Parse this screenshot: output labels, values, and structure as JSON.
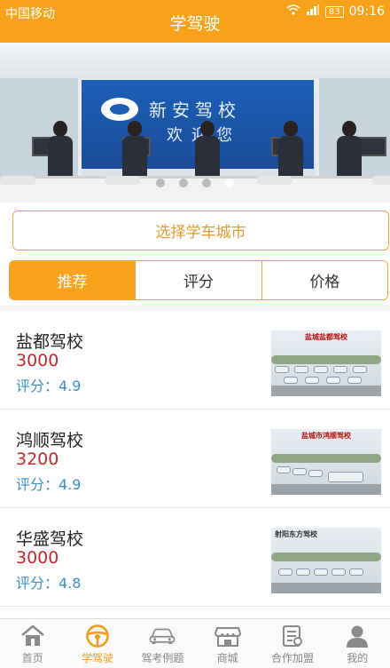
{
  "status_bar": {
    "carrier": "中国移动",
    "battery": "83",
    "time": "09:16"
  },
  "header": {
    "title": "学驾驶"
  },
  "banner": {
    "sign_line1": "新安驾校",
    "sign_line2": "欢迎您",
    "slide_count": 4,
    "active_slide": 4
  },
  "city_button": {
    "label": "选择学车城市"
  },
  "tabs": [
    {
      "label": "推荐",
      "active": true
    },
    {
      "label": "评分",
      "active": false
    },
    {
      "label": "价格",
      "active": false
    }
  ],
  "schools": [
    {
      "name": "盐都驾校",
      "price": "3000",
      "rating": "评分：4.9",
      "thumb_caption": "盐城盐都驾校"
    },
    {
      "name": "鸿顺驾校",
      "price": "3200",
      "rating": "评分：4.9",
      "thumb_caption": "盐城市鸿顺驾校"
    },
    {
      "name": "华盛驾校",
      "price": "3000",
      "rating": "评分：4.8",
      "thumb_caption": "射阳东方驾校"
    }
  ],
  "bottom_nav": [
    {
      "label": "首页",
      "icon": "home-icon",
      "active": false
    },
    {
      "label": "学驾驶",
      "icon": "steering-wheel-icon",
      "active": true
    },
    {
      "label": "驾考例题",
      "icon": "car-icon",
      "active": false
    },
    {
      "label": "商城",
      "icon": "store-icon",
      "active": false
    },
    {
      "label": "合作加盟",
      "icon": "document-icon",
      "active": false
    },
    {
      "label": "我的",
      "icon": "user-icon",
      "active": false
    }
  ],
  "colors": {
    "accent": "#f7a21a",
    "price": "#c8262b",
    "rating": "#3a8fc7"
  }
}
